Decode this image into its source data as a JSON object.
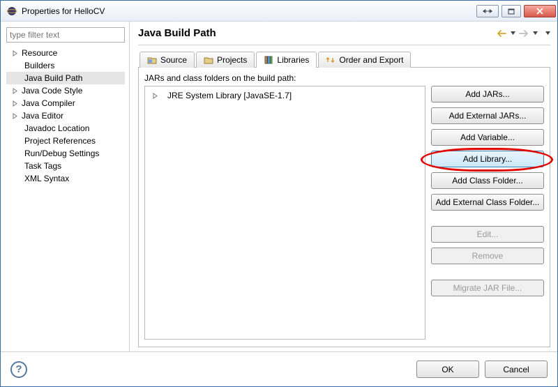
{
  "window": {
    "title": "Properties for HelloCV"
  },
  "filter_placeholder": "type filter text",
  "tree": {
    "items": [
      {
        "label": "Resource",
        "expandable": true
      },
      {
        "label": "Builders",
        "expandable": false
      },
      {
        "label": "Java Build Path",
        "expandable": false,
        "selected": true
      },
      {
        "label": "Java Code Style",
        "expandable": true
      },
      {
        "label": "Java Compiler",
        "expandable": true
      },
      {
        "label": "Java Editor",
        "expandable": true
      },
      {
        "label": "Javadoc Location",
        "expandable": false
      },
      {
        "label": "Project References",
        "expandable": false
      },
      {
        "label": "Run/Debug Settings",
        "expandable": false
      },
      {
        "label": "Task Tags",
        "expandable": false
      },
      {
        "label": "XML Syntax",
        "expandable": false
      }
    ]
  },
  "page": {
    "heading": "Java Build Path",
    "tabs": {
      "source": "Source",
      "projects": "Projects",
      "libraries": "Libraries",
      "order": "Order and Export"
    },
    "panel_label": "JARs and class folders on the build path:",
    "list_item": "JRE System Library [JavaSE-1.7]",
    "buttons": {
      "add_jars": "Add JARs...",
      "add_ext_jars": "Add External JARs...",
      "add_variable": "Add Variable...",
      "add_library": "Add Library...",
      "add_class_folder": "Add Class Folder...",
      "add_ext_class_folder": "Add External Class Folder...",
      "edit": "Edit...",
      "remove": "Remove",
      "migrate": "Migrate JAR File..."
    }
  },
  "footer": {
    "ok": "OK",
    "cancel": "Cancel"
  }
}
